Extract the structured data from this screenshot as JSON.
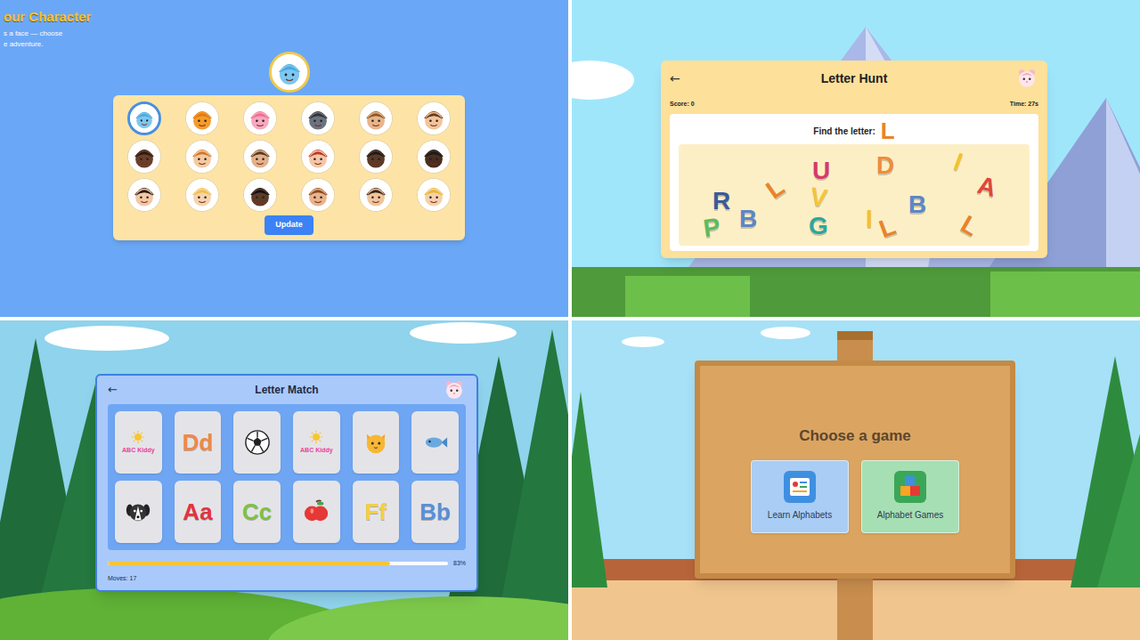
{
  "character": {
    "title": "our Character",
    "subtitle": [
      "s a face — choose",
      "e adventure."
    ],
    "button": "Update",
    "avatars": [
      {
        "selected": true
      },
      {
        "selected": false
      },
      {
        "selected": false
      },
      {
        "selected": false
      },
      {
        "selected": false
      },
      {
        "selected": false
      },
      {
        "selected": false
      },
      {
        "selected": false
      },
      {
        "selected": false
      },
      {
        "selected": false
      },
      {
        "selected": false
      },
      {
        "selected": false
      },
      {
        "selected": false
      },
      {
        "selected": false
      },
      {
        "selected": false
      },
      {
        "selected": false
      },
      {
        "selected": false
      },
      {
        "selected": false
      }
    ]
  },
  "letterHunt": {
    "back": "←",
    "title": "Letter Hunt",
    "score": "Score: 0",
    "time": "Time: 27s",
    "prompt": "Find the letter:",
    "target": "L",
    "letters": [
      {
        "char": "R",
        "color": "#3b5a9a"
      },
      {
        "char": "B",
        "color": "#5b86c9"
      },
      {
        "char": "L",
        "color": "#e8842c"
      },
      {
        "char": "U",
        "color": "#d63a6a"
      },
      {
        "char": "V",
        "color": "#f3c53a"
      },
      {
        "char": "G",
        "color": "#2aa7a0"
      },
      {
        "char": "D",
        "color": "#ef8c3c"
      },
      {
        "char": "I",
        "color": "#f2c230"
      },
      {
        "char": "I",
        "color": "#f2c230"
      },
      {
        "char": "L",
        "color": "#e8842c"
      },
      {
        "char": "B",
        "color": "#5b86c9"
      },
      {
        "char": "A",
        "color": "#e0463c"
      },
      {
        "char": "P",
        "color": "#5dbb63"
      },
      {
        "char": "L",
        "color": "#e8842c"
      }
    ]
  },
  "letterMatch": {
    "back": "←",
    "title": "Letter Match",
    "cards": [
      {
        "kind": "back",
        "label": "ABC Kiddy"
      },
      {
        "kind": "letter",
        "label": "Dd",
        "color": "#f0884a"
      },
      {
        "kind": "ball"
      },
      {
        "kind": "back",
        "label": "ABC Kiddy"
      },
      {
        "kind": "cat"
      },
      {
        "kind": "fish"
      },
      {
        "kind": "dog"
      },
      {
        "kind": "letter",
        "label": "Aa",
        "color": "#e2343f"
      },
      {
        "kind": "letter",
        "label": "Cc",
        "color": "#7dc242"
      },
      {
        "kind": "apple"
      },
      {
        "kind": "letter",
        "label": "Ff",
        "color": "#f4d03f"
      },
      {
        "kind": "letter",
        "label": "Bb",
        "color": "#5b8fd6"
      }
    ],
    "progress": {
      "level": 0.83,
      "reading": "83%"
    },
    "moves": "Moves: 17"
  },
  "gameMenu": {
    "title": "Choose a game",
    "options": [
      {
        "label": "Learn Alphabets",
        "kind": "learn",
        "color": "#a9cdf5"
      },
      {
        "label": "Alphabet Games",
        "kind": "games",
        "color": "#a6dfb3"
      }
    ]
  }
}
